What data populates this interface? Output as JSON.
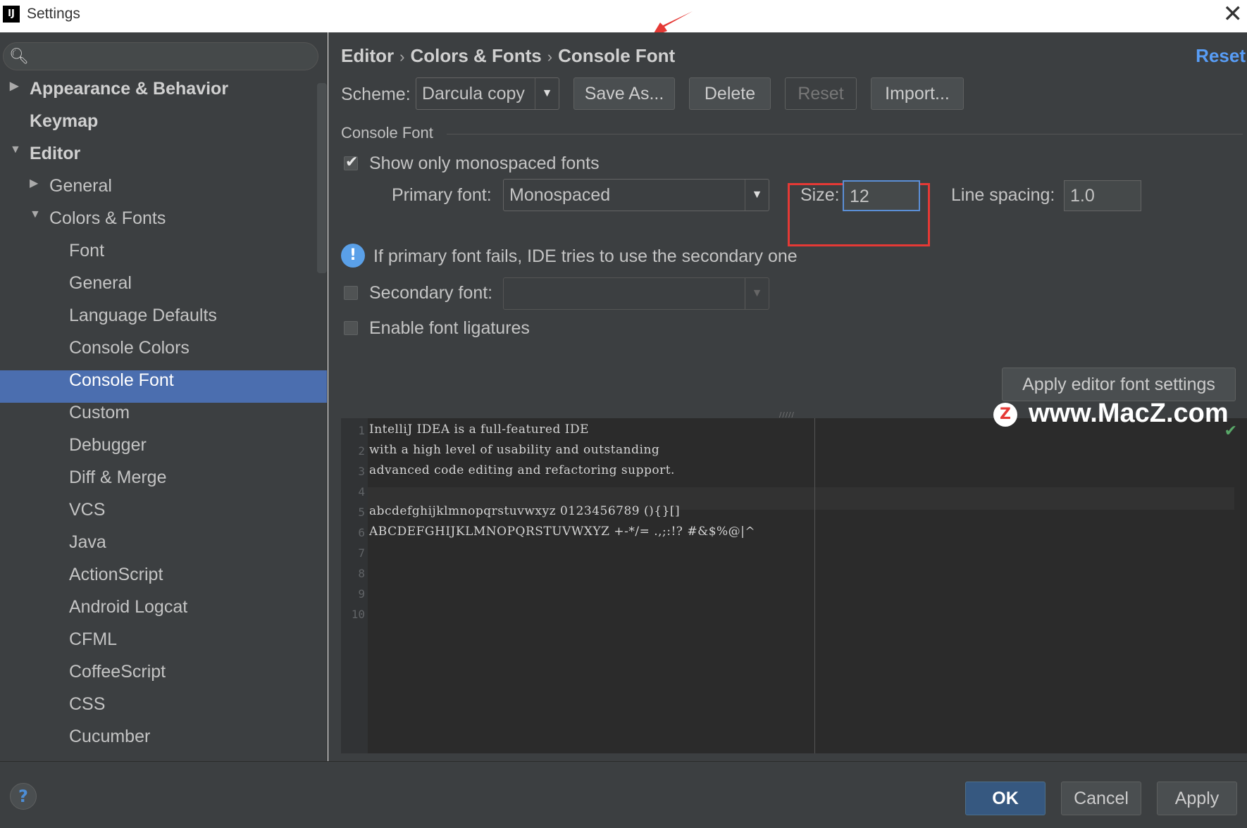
{
  "window": {
    "title": "Settings",
    "app_icon": "IJ",
    "close_glyph": "✕"
  },
  "search": {
    "value": "",
    "placeholder": ""
  },
  "sidebar": {
    "items": [
      {
        "label": "Appearance & Behavior",
        "arrow": "▶"
      },
      {
        "label": "Keymap"
      },
      {
        "label": "Editor",
        "arrow": "▼"
      },
      {
        "label": "General",
        "arrow": "▶"
      },
      {
        "label": "Colors & Fonts",
        "arrow": "▼"
      },
      {
        "label": "Font"
      },
      {
        "label": "General"
      },
      {
        "label": "Language Defaults"
      },
      {
        "label": "Console Colors"
      },
      {
        "label": "Console Font",
        "selected": true
      },
      {
        "label": "Custom"
      },
      {
        "label": "Debugger"
      },
      {
        "label": "Diff & Merge"
      },
      {
        "label": "VCS"
      },
      {
        "label": "Java"
      },
      {
        "label": "ActionScript"
      },
      {
        "label": "Android Logcat"
      },
      {
        "label": "CFML"
      },
      {
        "label": "CoffeeScript"
      },
      {
        "label": "CSS"
      },
      {
        "label": "Cucumber"
      }
    ]
  },
  "header": {
    "breadcrumb": [
      "Editor",
      "Colors & Fonts",
      "Console Font"
    ],
    "separator": "›",
    "reset_link": "Reset"
  },
  "scheme": {
    "label": "Scheme:",
    "value": "Darcula copy",
    "save_as": "Save As...",
    "delete": "Delete",
    "reset": "Reset",
    "import": "Import..."
  },
  "console_font": {
    "section_title": "Console Font",
    "show_mono_label": "Show only monospaced fonts",
    "show_mono_checked": true,
    "primary_label": "Primary font:",
    "primary_value": "Monospaced",
    "size_label": "Size:",
    "size_value": "12",
    "line_spacing_label": "Line spacing:",
    "line_spacing_value": "1.0",
    "info_text": "If primary font fails, IDE tries to use the secondary one",
    "secondary_label": "Secondary font:",
    "secondary_checked": false,
    "secondary_value": "",
    "ligatures_label": "Enable font ligatures",
    "ligatures_checked": false,
    "apply_editor_btn": "Apply editor font settings"
  },
  "preview": {
    "line_numbers": [
      "1",
      "2",
      "3",
      "4",
      "5",
      "6",
      "7",
      "8",
      "9",
      "10"
    ],
    "lines": [
      "IntelliJ IDEA is a full-featured IDE",
      "with a high level of usability and outstanding",
      "advanced code editing and refactoring support.",
      "",
      "abcdefghijklmnopqrstuvwxyz 0123456789 (){}[]",
      "ABCDEFGHIJKLMNOPQRSTUVWXYZ +-*/= .,;:!? #&$%@|^"
    ]
  },
  "watermark": {
    "text": "www.MacZ.com",
    "logo": "Z"
  },
  "footer": {
    "help": "?",
    "ok": "OK",
    "cancel": "Cancel",
    "apply": "Apply"
  },
  "colors": {
    "accent": "#4b6eaf",
    "highlight": "#e53935",
    "link": "#589df6"
  }
}
